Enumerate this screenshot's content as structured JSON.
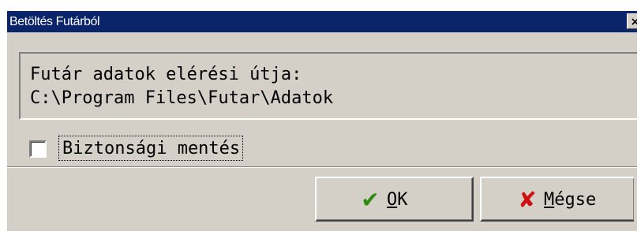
{
  "window": {
    "title": "Betöltés Futárból",
    "close_glyph": "×"
  },
  "path_panel": {
    "line1": "Futár adatok elérési útja:",
    "line2": "C:\\Program Files\\Futar\\Adatok"
  },
  "backup": {
    "label": "Biztonsági mentés",
    "checked": false
  },
  "buttons": {
    "ok": {
      "label_mnemonic": "O",
      "label_rest": "K",
      "icon": "checkmark-icon"
    },
    "cancel": {
      "label_mnemonic": "M",
      "label_rest": "égse",
      "icon": "cross-icon"
    }
  },
  "colors": {
    "titlebar": "#0a246a",
    "face": "#d4d0c8",
    "ok_icon": "#2e8b10",
    "cancel_icon": "#d01010"
  }
}
